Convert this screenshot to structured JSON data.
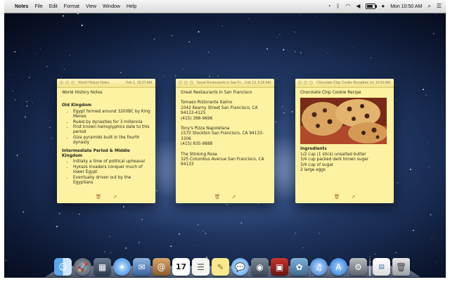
{
  "menubar": {
    "app_name": "Notes",
    "menus": [
      "File",
      "Edit",
      "Format",
      "View",
      "Window",
      "Help"
    ],
    "clock": "Mon 10:50 AM",
    "status_icons": [
      "time-machine-icon",
      "bluetooth-icon",
      "wifi-icon",
      "volume-icon",
      "battery-icon",
      "user-icon",
      "spotlight-icon",
      "notification-icon"
    ]
  },
  "notes": [
    {
      "title": "World History Notes",
      "date": "Feb 1, 10:27 AM",
      "heading": "World History Notes",
      "sec1": "Old Kingdom",
      "items1": [
        "Egypt formed around 3200BC by King Menes",
        "Ruled by dynasties for 3 millennia",
        "First known heiroglyphics date to this period",
        "Giza pyramids built in the fourth dynasty"
      ],
      "sec2": "Intermediate Period & Middle Kingdom",
      "items2": [
        "Initially a time of political upheaval",
        "Hyksos invaders conquer much of lower Egypt",
        "Eventually driven out by the Egyptians"
      ]
    },
    {
      "title": "Great Restaurants in San Francisco",
      "date": "Feb 13, 9:36 AM",
      "heading": "Great Restaurants in San Francisco",
      "r1": [
        "Tomaso Ristorante Italino",
        "1042 Kearny Street San Francisco, CA 94133-4125",
        "(415) 398-9696"
      ],
      "r2": [
        "Tony's Pizza Napoletana",
        "1570 Stockton San Francisco, CA 94133-3306",
        "(415) 835-9888"
      ],
      "r3": [
        "The Stinking Rose",
        "325 Columbus Avenue San Francisco, CA 94133"
      ]
    },
    {
      "title": "Chocolate Chip Cookie Recipe",
      "date": "Feb 14, 10:50 AM",
      "heading": "Chocolate Chip Cookie Recipe",
      "ingredients_label": "Ingredients",
      "ingredients": [
        "1/2 cup (1 stick) unsalted butter",
        "3/4 cup packed dark brown sugar",
        "3/4 cup of sugar",
        "2 large eggs"
      ]
    }
  ],
  "note_footer_icons": [
    "trash-icon",
    "share-icon"
  ],
  "dock": [
    "finder",
    "launchpad",
    "mission-control",
    "safari",
    "mail",
    "contacts",
    "calendar",
    "reminders",
    "notes",
    "messages",
    "facetime",
    "photo-booth",
    "iphoto",
    "itunes",
    "app-store",
    "system-preferences",
    "documents",
    "trash"
  ],
  "colors": {
    "note_bg": "#fdf2a2",
    "note_titlebar": "#f0e18a",
    "wallpaper": "#1f3560"
  }
}
